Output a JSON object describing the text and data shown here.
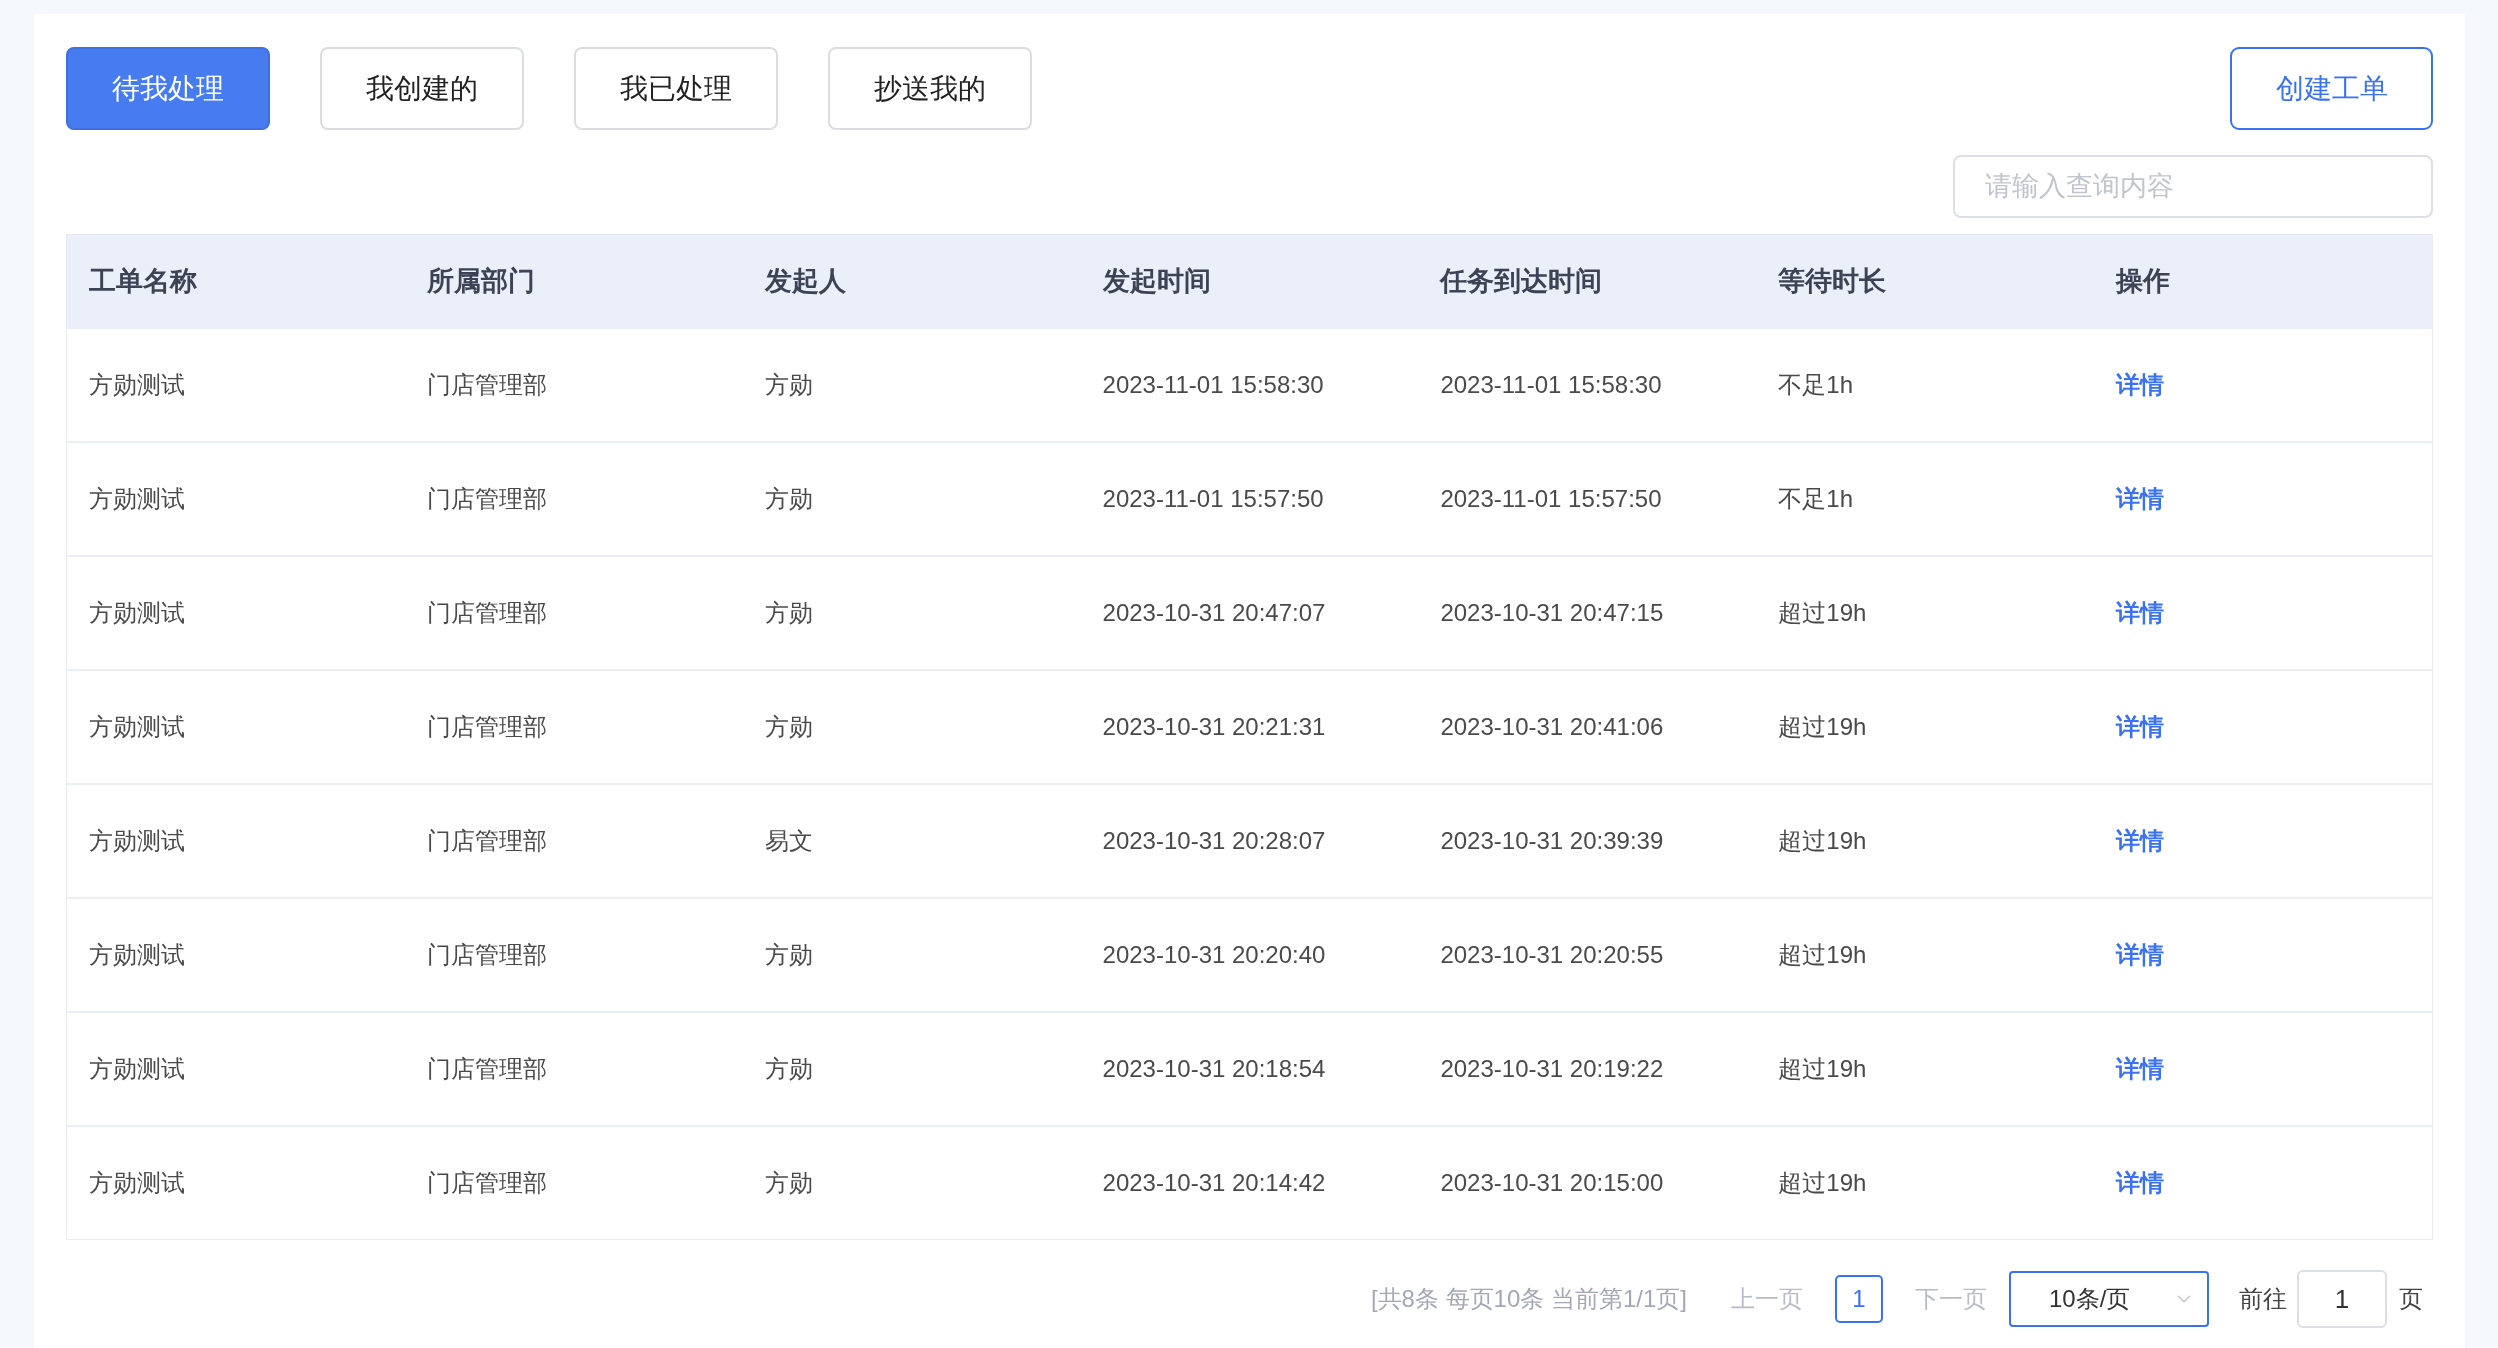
{
  "tabs": [
    {
      "label": "待我处理",
      "selected": true
    },
    {
      "label": "我创建的",
      "selected": false
    },
    {
      "label": "我已处理",
      "selected": false
    },
    {
      "label": "抄送我的",
      "selected": false
    }
  ],
  "create_button": "创建工单",
  "search": {
    "placeholder": "请输入查询内容"
  },
  "table": {
    "columns": [
      "工单名称",
      "所属部门",
      "发起人",
      "发起时间",
      "任务到达时间",
      "等待时长",
      "操作"
    ],
    "rows": [
      [
        "方勋测试",
        "门店管理部",
        "方勋",
        "2023-11-01 15:58:30",
        "2023-11-01 15:58:30",
        "不足1h",
        "详情"
      ],
      [
        "方勋测试",
        "门店管理部",
        "方勋",
        "2023-11-01 15:57:50",
        "2023-11-01 15:57:50",
        "不足1h",
        "详情"
      ],
      [
        "方勋测试",
        "门店管理部",
        "方勋",
        "2023-10-31 20:47:07",
        "2023-10-31 20:47:15",
        "超过19h",
        "详情"
      ],
      [
        "方勋测试",
        "门店管理部",
        "方勋",
        "2023-10-31 20:21:31",
        "2023-10-31 20:41:06",
        "超过19h",
        "详情"
      ],
      [
        "方勋测试",
        "门店管理部",
        "易文",
        "2023-10-31 20:28:07",
        "2023-10-31 20:39:39",
        "超过19h",
        "详情"
      ],
      [
        "方勋测试",
        "门店管理部",
        "方勋",
        "2023-10-31 20:20:40",
        "2023-10-31 20:20:55",
        "超过19h",
        "详情"
      ],
      [
        "方勋测试",
        "门店管理部",
        "方勋",
        "2023-10-31 20:18:54",
        "2023-10-31 20:19:22",
        "超过19h",
        "详情"
      ],
      [
        "方勋测试",
        "门店管理部",
        "方勋",
        "2023-10-31 20:14:42",
        "2023-10-31 20:15:00",
        "超过19h",
        "详情"
      ]
    ]
  },
  "pagination": {
    "summary": "[共8条 每页10条 当前第1/1页]",
    "prev": "上一页",
    "pages": [
      {
        "label": "1",
        "selected": true
      }
    ],
    "next": "下一页",
    "page_size": "10条/页",
    "goto_label": "前往",
    "goto_value": "1",
    "goto_suffix": "页"
  }
}
